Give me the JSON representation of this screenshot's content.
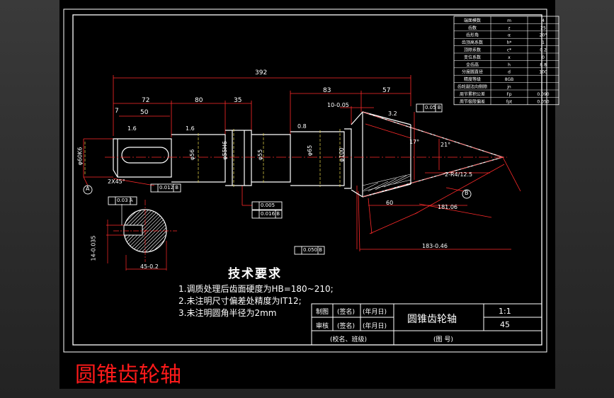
{
  "caption": "圆锥齿轮轴",
  "params": {
    "rows": [
      {
        "name": "端面模数",
        "sym": "m",
        "val": "4"
      },
      {
        "name": "齿数",
        "sym": "z",
        "val": "25"
      },
      {
        "name": "齿形角",
        "sym": "α",
        "val": "20°"
      },
      {
        "name": "齿顶高系数",
        "sym": "h*",
        "val": "1"
      },
      {
        "name": "顶隙系数",
        "sym": "c*",
        "val": "0.2"
      },
      {
        "name": "变位系数",
        "sym": "x",
        "val": "0"
      },
      {
        "name": "全齿高",
        "sym": "h",
        "val": "8.8"
      },
      {
        "name": "分度圆直径",
        "sym": "d",
        "val": "100"
      },
      {
        "name": "精度等级",
        "sym": "8GB",
        "val": ""
      },
      {
        "name": "齿轮副法向侧隙",
        "sym": "jn",
        "val": ""
      },
      {
        "name": "周节累积公差",
        "sym": "Fp",
        "val": "0.090"
      },
      {
        "name": "周节极限偏差",
        "sym": "fpt",
        "val": "0.050"
      }
    ]
  },
  "dims": {
    "total": "392",
    "d72": "72",
    "d80": "80",
    "d35": "35",
    "d83": "83",
    "d57": "57",
    "d7": "7",
    "d50": "50",
    "chamfer": "2X45°",
    "label_a": "A",
    "label_b": "B",
    "dia1": "φ60K6",
    "dia2": "φ56",
    "dia3": "φ55H6",
    "dia4": "φ55",
    "dia5": "φ65",
    "dia6": "φ100",
    "key_depth": "45-0.2",
    "key_width": "14-0.035",
    "d60": "60",
    "d181": "181.06",
    "d183": "183-0.46",
    "r25": "2-R4/12.5",
    "ang17": "17°",
    "ang21": "21°",
    "d10": "10-0.05",
    "ra1": "1.6",
    "ra2": "1.6",
    "ra3": "0.8",
    "ra4": "3.2"
  },
  "tolerances": {
    "t1": "0.05  B",
    "t2": "0.012  B",
    "t3": "0.005",
    "t4": "0.016  B",
    "t5": "0.03  A",
    "t6": "0.050  B"
  },
  "notes": {
    "heading": "技术要求",
    "items": [
      "1.调质处理后齿面硬度为HB=180~210;",
      "2.未注明尺寸偏差处精度为IT12;",
      "3.未注明圆角半径为2mm"
    ]
  },
  "title_block": {
    "draw": "制图",
    "check": "审核",
    "sign1": "(签名)",
    "sign2": "(签名)",
    "date1": "(年月日)",
    "date2": "(年月日)",
    "school": "(校名、班级)",
    "part_name": "圆锥齿轮轴",
    "scale": "1:1",
    "material": "45",
    "drawing_no": "(图  号)"
  }
}
